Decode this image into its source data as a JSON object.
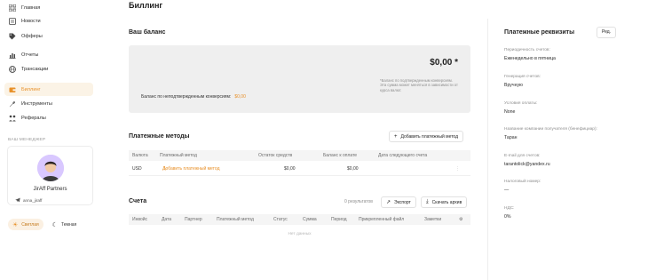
{
  "sidebar": {
    "items": [
      {
        "label": "Главная",
        "icon": "grid-icon"
      },
      {
        "label": "Новости",
        "icon": "news-icon"
      },
      {
        "label": "Офферы",
        "icon": "tag-icon"
      },
      {
        "label": "Отчеты",
        "icon": "chart-icon"
      },
      {
        "label": "Трансакции",
        "icon": "globe-icon"
      },
      {
        "label": "Биллинг",
        "icon": "wallet-icon",
        "active": true
      },
      {
        "label": "Инструменты",
        "icon": "wrench-icon"
      },
      {
        "label": "Рефералы",
        "icon": "referral-icon"
      }
    ],
    "manager_section_label": "ВАШ МЕНЕДЖЕР",
    "manager": {
      "name": "JirAff Partners",
      "telegram": "anna_jiraff"
    },
    "theme": {
      "light": "Светлая",
      "dark": "Темная"
    },
    "accent_color": "#e8912a"
  },
  "main": {
    "title": "Биллинг",
    "balance": {
      "heading": "Ваш баланс",
      "amount": "$0,00 *",
      "note": "*Баланс по подтвержденным конверсиям. Эта сумма может меняться в зависимости от курса валют.",
      "pending_label": "Баланс по неподтвержденным конверсиям:",
      "pending_value": "$0,00"
    },
    "payment_methods": {
      "heading": "Платежные методы",
      "add_button": "Добавить платежный метод",
      "columns": [
        "Валюта",
        "Платежный метод",
        "Остаток средств",
        "Баланс к оплате",
        "Дата следующего счета"
      ],
      "rows": [
        {
          "currency": "USD",
          "method": "Добавить платежный метод",
          "remaining": "$0,00",
          "due": "$0,00",
          "next_date": "",
          "more": "⋮"
        }
      ]
    },
    "invoices": {
      "heading": "Счета",
      "results": "0 результатов",
      "export_button": "Экспорт",
      "download_button": "Скачать архив",
      "columns": [
        "Инвойс",
        "Дата",
        "Партнер",
        "Платежный метод",
        "Статус",
        "Сумма",
        "Период",
        "Прикрепленный файл",
        "Заметки"
      ],
      "empty": "Нет данных"
    }
  },
  "details": {
    "title": "Платежные реквизиты",
    "edit_button": "Ред.",
    "fields": [
      {
        "label": "Периодичность счетов:",
        "value": "Еженедельно в пятница"
      },
      {
        "label": "Генерация счетов:",
        "value": "Вручную"
      },
      {
        "label": "Условия оплаты:",
        "value": "None"
      },
      {
        "label": "Название компании получателя (бенефициар):",
        "value": "Таран"
      },
      {
        "label": "E-mail для счетов:",
        "value": "tarantolick@yandex.ru"
      },
      {
        "label": "Налоговый номер:",
        "value": "—"
      },
      {
        "label": "НДС:",
        "value": "0%"
      }
    ]
  }
}
